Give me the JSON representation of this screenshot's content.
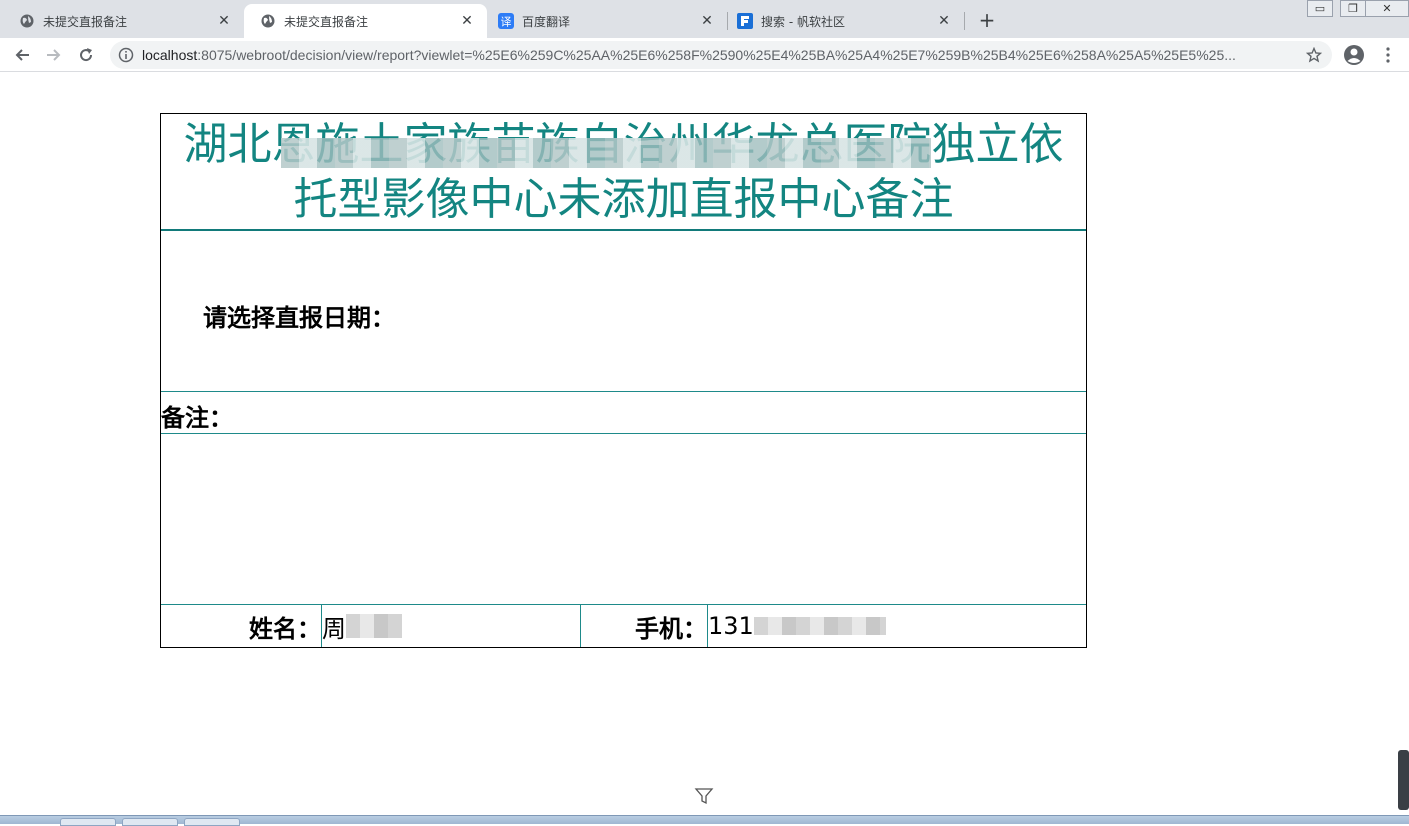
{
  "tabs": [
    {
      "title": "未提交直报备注",
      "icon": "globe-icon",
      "active": false
    },
    {
      "title": "未提交直报备注",
      "icon": "globe-icon",
      "active": true
    },
    {
      "title": "百度翻译",
      "icon": "baidu-translate-icon",
      "active": false
    },
    {
      "title": "搜索 - 帆软社区",
      "icon": "fanruan-icon",
      "active": false
    }
  ],
  "toolbar": {
    "url_host": "localhost",
    "url_rest": ":8075/webroot/decision/view/report?viewlet=%25E6%259C%25AA%25E6%258F%2590%25E4%25BA%25A4%25E7%259B%25B4%25E6%258A%25A5%25E5%25..."
  },
  "report": {
    "title": "湖北恩施土家族苗族自治州华龙总医院独立依托型影像中心未添加直报中心备注",
    "date_label": "请选择直报日期：",
    "note_label": "备注：",
    "name_label": "姓名：",
    "name_value": "周",
    "phone_label": "手机：",
    "phone_value": "131"
  },
  "colors": {
    "title_teal": "#138581",
    "grid_teal": "#1e8a8a",
    "tabstrip_bg": "#dee1e6",
    "omnibox_bg": "#f1f3f4"
  }
}
